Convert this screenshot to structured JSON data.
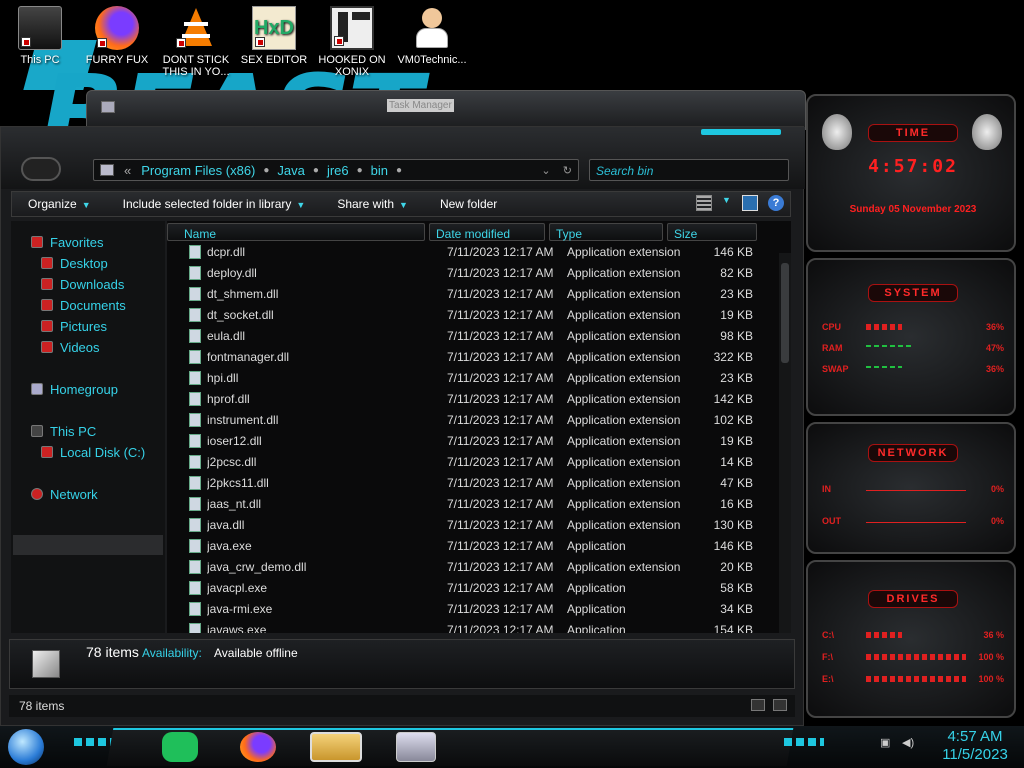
{
  "desktop": {
    "background_text": "BEAST",
    "icons": [
      {
        "label": "This PC",
        "icon": "computer-icon"
      },
      {
        "label": "FURRY FUX",
        "icon": "firefox-icon"
      },
      {
        "label": "DONT STICK THIS IN YO...",
        "icon": "vlc-icon"
      },
      {
        "label": "SEX EDITOR",
        "icon": "hxd-icon"
      },
      {
        "label": "HOOKED ON XONIX",
        "icon": "game-icon"
      },
      {
        "label": "VM0Technic...",
        "icon": "doctor-icon"
      }
    ]
  },
  "back_window": {
    "title": "Task Manager"
  },
  "explorer": {
    "breadcrumb": [
      "Program Files (x86)",
      "Java",
      "jre6",
      "bin"
    ],
    "search_placeholder": "Search bin",
    "toolbar": {
      "organize": "Organize",
      "include": "Include selected folder in library",
      "share": "Share with",
      "new_folder": "New folder"
    },
    "nav": {
      "favorites": "Favorites",
      "desktop": "Desktop",
      "downloads": "Downloads",
      "documents": "Documents",
      "pictures": "Pictures",
      "videos": "Videos",
      "homegroup": "Homegroup",
      "this_pc": "This PC",
      "local_disk": "Local Disk (C:)",
      "network": "Network"
    },
    "columns": {
      "name": "Name",
      "date": "Date modified",
      "type": "Type",
      "size": "Size"
    },
    "files": [
      {
        "name": "dcpr.dll",
        "date": "7/11/2023 12:17 AM",
        "type": "Application extension",
        "size": "146 KB"
      },
      {
        "name": "deploy.dll",
        "date": "7/11/2023 12:17 AM",
        "type": "Application extension",
        "size": "82 KB"
      },
      {
        "name": "dt_shmem.dll",
        "date": "7/11/2023 12:17 AM",
        "type": "Application extension",
        "size": "23 KB"
      },
      {
        "name": "dt_socket.dll",
        "date": "7/11/2023 12:17 AM",
        "type": "Application extension",
        "size": "19 KB"
      },
      {
        "name": "eula.dll",
        "date": "7/11/2023 12:17 AM",
        "type": "Application extension",
        "size": "98 KB"
      },
      {
        "name": "fontmanager.dll",
        "date": "7/11/2023 12:17 AM",
        "type": "Application extension",
        "size": "322 KB"
      },
      {
        "name": "hpi.dll",
        "date": "7/11/2023 12:17 AM",
        "type": "Application extension",
        "size": "23 KB"
      },
      {
        "name": "hprof.dll",
        "date": "7/11/2023 12:17 AM",
        "type": "Application extension",
        "size": "142 KB"
      },
      {
        "name": "instrument.dll",
        "date": "7/11/2023 12:17 AM",
        "type": "Application extension",
        "size": "102 KB"
      },
      {
        "name": "ioser12.dll",
        "date": "7/11/2023 12:17 AM",
        "type": "Application extension",
        "size": "19 KB"
      },
      {
        "name": "j2pcsc.dll",
        "date": "7/11/2023 12:17 AM",
        "type": "Application extension",
        "size": "14 KB"
      },
      {
        "name": "j2pkcs11.dll",
        "date": "7/11/2023 12:17 AM",
        "type": "Application extension",
        "size": "47 KB"
      },
      {
        "name": "jaas_nt.dll",
        "date": "7/11/2023 12:17 AM",
        "type": "Application extension",
        "size": "16 KB"
      },
      {
        "name": "java.dll",
        "date": "7/11/2023 12:17 AM",
        "type": "Application extension",
        "size": "130 KB"
      },
      {
        "name": "java.exe",
        "date": "7/11/2023 12:17 AM",
        "type": "Application",
        "size": "146 KB"
      },
      {
        "name": "java_crw_demo.dll",
        "date": "7/11/2023 12:17 AM",
        "type": "Application extension",
        "size": "20 KB"
      },
      {
        "name": "javacpl.exe",
        "date": "7/11/2023 12:17 AM",
        "type": "Application",
        "size": "58 KB"
      },
      {
        "name": "java-rmi.exe",
        "date": "7/11/2023 12:17 AM",
        "type": "Application",
        "size": "34 KB"
      },
      {
        "name": "javaws.exe",
        "date": "7/11/2023 12:17 AM",
        "type": "Application",
        "size": "154 KB"
      }
    ],
    "details": {
      "count": "78 items",
      "availability_label": "Availability:",
      "availability_value": "Available offline"
    },
    "status_count": "78 items"
  },
  "gadgets": {
    "time": {
      "title": "TIME",
      "clock": "4:57:02",
      "date": "Sunday 05 November 2023"
    },
    "system": {
      "title": "SYSTEM",
      "meters": [
        {
          "label": "CPU",
          "value": "36%",
          "level": 0.36
        },
        {
          "label": "RAM",
          "value": "47%",
          "level": 0.47
        },
        {
          "label": "SWAP",
          "value": "36%",
          "level": 0.36
        }
      ]
    },
    "network": {
      "title": "NETWORK",
      "in_label": "IN",
      "in_value": "0%",
      "out_label": "OUT",
      "out_value": "0%"
    },
    "drives": {
      "title": "DRIVES",
      "items": [
        {
          "label": "C:\\",
          "value": "36 %",
          "level": 0.36
        },
        {
          "label": "F:\\",
          "value": "100 %",
          "level": 1.0
        },
        {
          "label": "E:\\",
          "value": "100 %",
          "level": 1.0
        }
      ]
    }
  },
  "taskbar": {
    "time": "4:57 AM",
    "date": "11/5/2023"
  },
  "colors": {
    "accent": "#1ec7e0",
    "link": "#36d2e8",
    "gadget_red": "#ff2020"
  }
}
